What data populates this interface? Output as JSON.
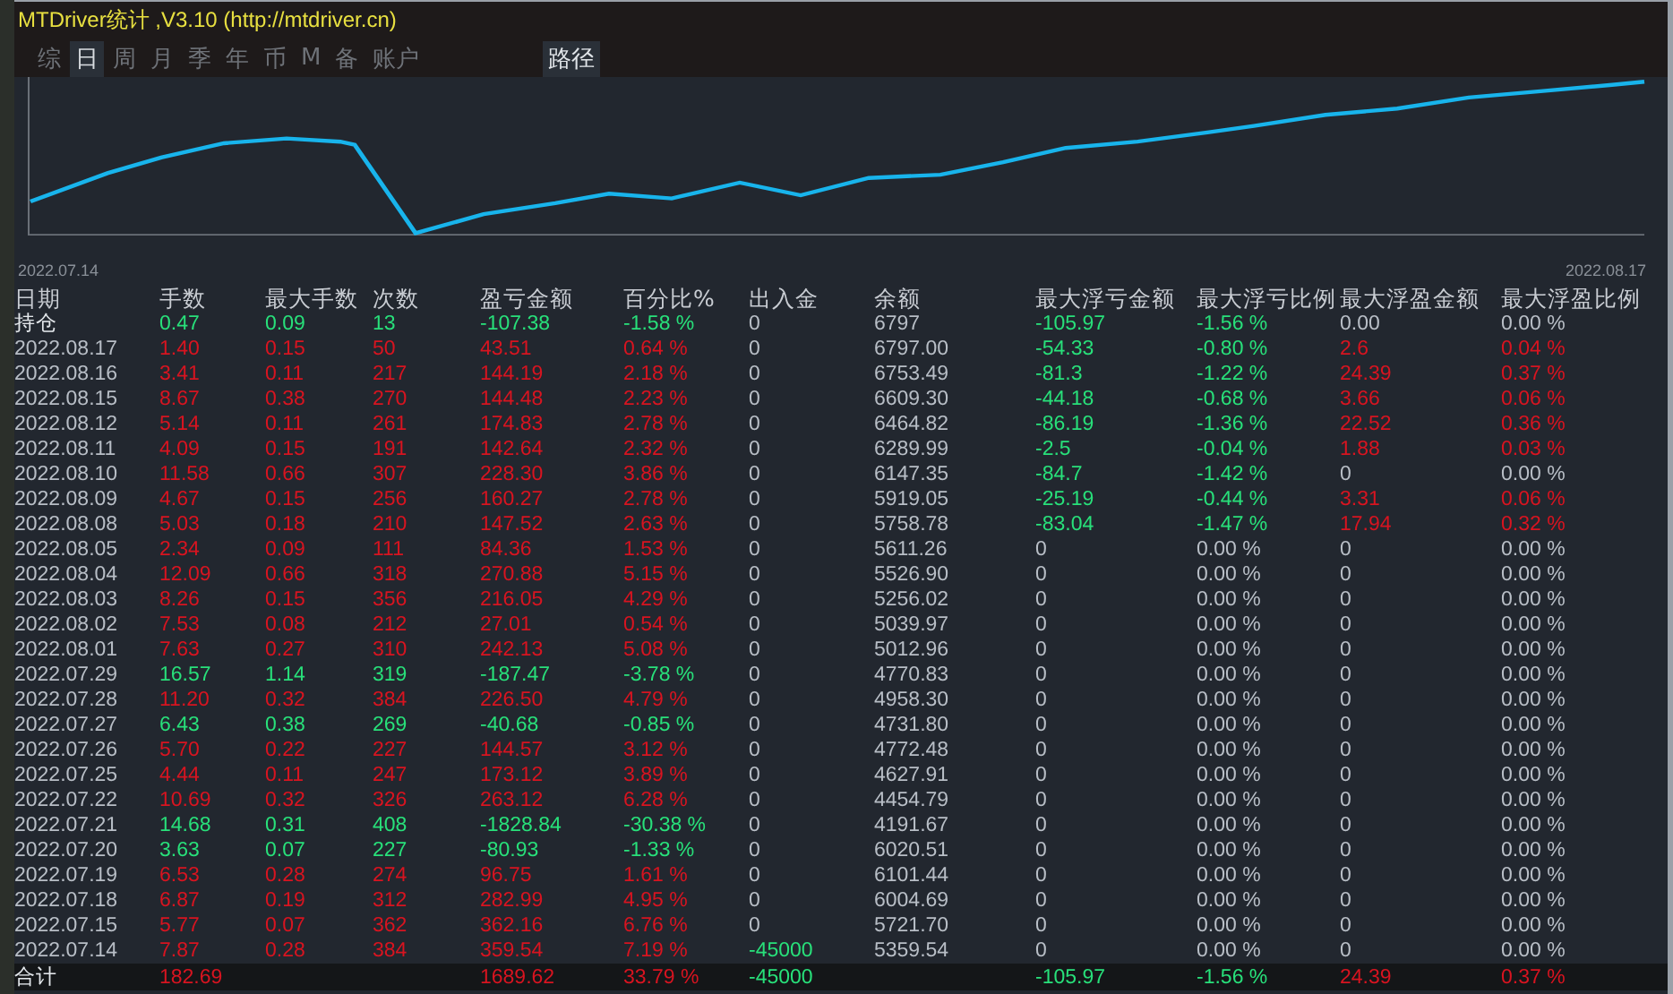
{
  "window": {
    "title": "MTDriver统计 ,V3.10 (http://mtdriver.cn)"
  },
  "tabs": [
    {
      "label": "综",
      "selected": false
    },
    {
      "label": "日",
      "selected": true
    },
    {
      "label": "周",
      "selected": false
    },
    {
      "label": "月",
      "selected": false
    },
    {
      "label": "季",
      "selected": false
    },
    {
      "label": "年",
      "selected": false
    },
    {
      "label": "币",
      "selected": false
    },
    {
      "label": "M",
      "selected": false
    },
    {
      "label": "备",
      "selected": false
    },
    {
      "label": "账户",
      "selected": false
    }
  ],
  "path_button": "路径",
  "chart": {
    "start_label": "2022.07.14",
    "end_label": "2022.08.17"
  },
  "table": {
    "columns": [
      "日期",
      "手数",
      "最大手数",
      "次数",
      "盈亏金额",
      "百分比%",
      "出入金",
      "余额",
      "最大浮亏金额",
      "最大浮亏比例",
      "最大浮盈金额",
      "最大浮盈比例"
    ],
    "rows": [
      {
        "kind": "position",
        "cells": [
          "持仓",
          "0.47",
          "0.09",
          "13",
          "-107.38",
          "-1.58 %",
          "0",
          "6797",
          "-105.97",
          "-1.56 %",
          "0.00",
          "0.00 %"
        ],
        "profit": false,
        "deposit": false,
        "float_loss": true,
        "float_gain": false
      },
      {
        "kind": "day",
        "cells": [
          "2022.08.17",
          "1.40",
          "0.15",
          "50",
          "43.51",
          "0.64 %",
          "0",
          "6797.00",
          "-54.33",
          "-0.80 %",
          "2.6",
          "0.04 %"
        ],
        "profit": true,
        "deposit": false,
        "float_loss": true,
        "float_gain": true
      },
      {
        "kind": "day",
        "cells": [
          "2022.08.16",
          "3.41",
          "0.11",
          "217",
          "144.19",
          "2.18 %",
          "0",
          "6753.49",
          "-81.3",
          "-1.22 %",
          "24.39",
          "0.37 %"
        ],
        "profit": true,
        "deposit": false,
        "float_loss": true,
        "float_gain": true
      },
      {
        "kind": "day",
        "cells": [
          "2022.08.15",
          "8.67",
          "0.38",
          "270",
          "144.48",
          "2.23 %",
          "0",
          "6609.30",
          "-44.18",
          "-0.68 %",
          "3.66",
          "0.06 %"
        ],
        "profit": true,
        "deposit": false,
        "float_loss": true,
        "float_gain": true
      },
      {
        "kind": "day",
        "cells": [
          "2022.08.12",
          "5.14",
          "0.11",
          "261",
          "174.83",
          "2.78 %",
          "0",
          "6464.82",
          "-86.19",
          "-1.36 %",
          "22.52",
          "0.36 %"
        ],
        "profit": true,
        "deposit": false,
        "float_loss": true,
        "float_gain": true
      },
      {
        "kind": "day",
        "cells": [
          "2022.08.11",
          "4.09",
          "0.15",
          "191",
          "142.64",
          "2.32 %",
          "0",
          "6289.99",
          "-2.5",
          "-0.04 %",
          "1.88",
          "0.03 %"
        ],
        "profit": true,
        "deposit": false,
        "float_loss": true,
        "float_gain": true
      },
      {
        "kind": "day",
        "cells": [
          "2022.08.10",
          "11.58",
          "0.66",
          "307",
          "228.30",
          "3.86 %",
          "0",
          "6147.35",
          "-84.7",
          "-1.42 %",
          "0",
          "0.00 %"
        ],
        "profit": true,
        "deposit": false,
        "float_loss": true,
        "float_gain": false
      },
      {
        "kind": "day",
        "cells": [
          "2022.08.09",
          "4.67",
          "0.15",
          "256",
          "160.27",
          "2.78 %",
          "0",
          "5919.05",
          "-25.19",
          "-0.44 %",
          "3.31",
          "0.06 %"
        ],
        "profit": true,
        "deposit": false,
        "float_loss": true,
        "float_gain": true
      },
      {
        "kind": "day",
        "cells": [
          "2022.08.08",
          "5.03",
          "0.18",
          "210",
          "147.52",
          "2.63 %",
          "0",
          "5758.78",
          "-83.04",
          "-1.47 %",
          "17.94",
          "0.32 %"
        ],
        "profit": true,
        "deposit": false,
        "float_loss": true,
        "float_gain": true
      },
      {
        "kind": "day",
        "cells": [
          "2022.08.05",
          "2.34",
          "0.09",
          "111",
          "84.36",
          "1.53 %",
          "0",
          "5611.26",
          "0",
          "0.00 %",
          "0",
          "0.00 %"
        ],
        "profit": true,
        "deposit": false,
        "float_loss": false,
        "float_gain": false
      },
      {
        "kind": "day",
        "cells": [
          "2022.08.04",
          "12.09",
          "0.66",
          "318",
          "270.88",
          "5.15 %",
          "0",
          "5526.90",
          "0",
          "0.00 %",
          "0",
          "0.00 %"
        ],
        "profit": true,
        "deposit": false,
        "float_loss": false,
        "float_gain": false
      },
      {
        "kind": "day",
        "cells": [
          "2022.08.03",
          "8.26",
          "0.15",
          "356",
          "216.05",
          "4.29 %",
          "0",
          "5256.02",
          "0",
          "0.00 %",
          "0",
          "0.00 %"
        ],
        "profit": true,
        "deposit": false,
        "float_loss": false,
        "float_gain": false
      },
      {
        "kind": "day",
        "cells": [
          "2022.08.02",
          "7.53",
          "0.08",
          "212",
          "27.01",
          "0.54 %",
          "0",
          "5039.97",
          "0",
          "0.00 %",
          "0",
          "0.00 %"
        ],
        "profit": true,
        "deposit": false,
        "float_loss": false,
        "float_gain": false
      },
      {
        "kind": "day",
        "cells": [
          "2022.08.01",
          "7.63",
          "0.27",
          "310",
          "242.13",
          "5.08 %",
          "0",
          "5012.96",
          "0",
          "0.00 %",
          "0",
          "0.00 %"
        ],
        "profit": true,
        "deposit": false,
        "float_loss": false,
        "float_gain": false
      },
      {
        "kind": "day",
        "cells": [
          "2022.07.29",
          "16.57",
          "1.14",
          "319",
          "-187.47",
          "-3.78 %",
          "0",
          "4770.83",
          "0",
          "0.00 %",
          "0",
          "0.00 %"
        ],
        "profit": false,
        "deposit": false,
        "float_loss": false,
        "float_gain": false
      },
      {
        "kind": "day",
        "cells": [
          "2022.07.28",
          "11.20",
          "0.32",
          "384",
          "226.50",
          "4.79 %",
          "0",
          "4958.30",
          "0",
          "0.00 %",
          "0",
          "0.00 %"
        ],
        "profit": true,
        "deposit": false,
        "float_loss": false,
        "float_gain": false
      },
      {
        "kind": "day",
        "cells": [
          "2022.07.27",
          "6.43",
          "0.38",
          "269",
          "-40.68",
          "-0.85 %",
          "0",
          "4731.80",
          "0",
          "0.00 %",
          "0",
          "0.00 %"
        ],
        "profit": false,
        "deposit": false,
        "float_loss": false,
        "float_gain": false
      },
      {
        "kind": "day",
        "cells": [
          "2022.07.26",
          "5.70",
          "0.22",
          "227",
          "144.57",
          "3.12 %",
          "0",
          "4772.48",
          "0",
          "0.00 %",
          "0",
          "0.00 %"
        ],
        "profit": true,
        "deposit": false,
        "float_loss": false,
        "float_gain": false
      },
      {
        "kind": "day",
        "cells": [
          "2022.07.25",
          "4.44",
          "0.11",
          "247",
          "173.12",
          "3.89 %",
          "0",
          "4627.91",
          "0",
          "0.00 %",
          "0",
          "0.00 %"
        ],
        "profit": true,
        "deposit": false,
        "float_loss": false,
        "float_gain": false
      },
      {
        "kind": "day",
        "cells": [
          "2022.07.22",
          "10.69",
          "0.32",
          "326",
          "263.12",
          "6.28 %",
          "0",
          "4454.79",
          "0",
          "0.00 %",
          "0",
          "0.00 %"
        ],
        "profit": true,
        "deposit": false,
        "float_loss": false,
        "float_gain": false
      },
      {
        "kind": "day",
        "cells": [
          "2022.07.21",
          "14.68",
          "0.31",
          "408",
          "-1828.84",
          "-30.38 %",
          "0",
          "4191.67",
          "0",
          "0.00 %",
          "0",
          "0.00 %"
        ],
        "profit": false,
        "deposit": false,
        "float_loss": false,
        "float_gain": false
      },
      {
        "kind": "day",
        "cells": [
          "2022.07.20",
          "3.63",
          "0.07",
          "227",
          "-80.93",
          "-1.33 %",
          "0",
          "6020.51",
          "0",
          "0.00 %",
          "0",
          "0.00 %"
        ],
        "profit": false,
        "deposit": false,
        "float_loss": false,
        "float_gain": false
      },
      {
        "kind": "day",
        "cells": [
          "2022.07.19",
          "6.53",
          "0.28",
          "274",
          "96.75",
          "1.61 %",
          "0",
          "6101.44",
          "0",
          "0.00 %",
          "0",
          "0.00 %"
        ],
        "profit": true,
        "deposit": false,
        "float_loss": false,
        "float_gain": false
      },
      {
        "kind": "day",
        "cells": [
          "2022.07.18",
          "6.87",
          "0.19",
          "312",
          "282.99",
          "4.95 %",
          "0",
          "6004.69",
          "0",
          "0.00 %",
          "0",
          "0.00 %"
        ],
        "profit": true,
        "deposit": false,
        "float_loss": false,
        "float_gain": false
      },
      {
        "kind": "day",
        "cells": [
          "2022.07.15",
          "5.77",
          "0.07",
          "362",
          "362.16",
          "6.76 %",
          "0",
          "5721.70",
          "0",
          "0.00 %",
          "0",
          "0.00 %"
        ],
        "profit": true,
        "deposit": false,
        "float_loss": false,
        "float_gain": false
      },
      {
        "kind": "day",
        "cells": [
          "2022.07.14",
          "7.87",
          "0.28",
          "384",
          "359.54",
          "7.19 %",
          "-45000",
          "5359.54",
          "0",
          "0.00 %",
          "0",
          "0.00 %"
        ],
        "profit": true,
        "deposit": true,
        "float_loss": false,
        "float_gain": false
      }
    ],
    "total": {
      "kind": "total",
      "cells": [
        "合计",
        "182.69",
        null,
        null,
        "1689.62",
        "33.79 %",
        "-45000",
        null,
        "-105.97",
        "-1.56 %",
        "24.39",
        "0.37 %"
      ],
      "profit": true,
      "deposit": true,
      "float_loss": true,
      "float_gain": true
    }
  }
}
